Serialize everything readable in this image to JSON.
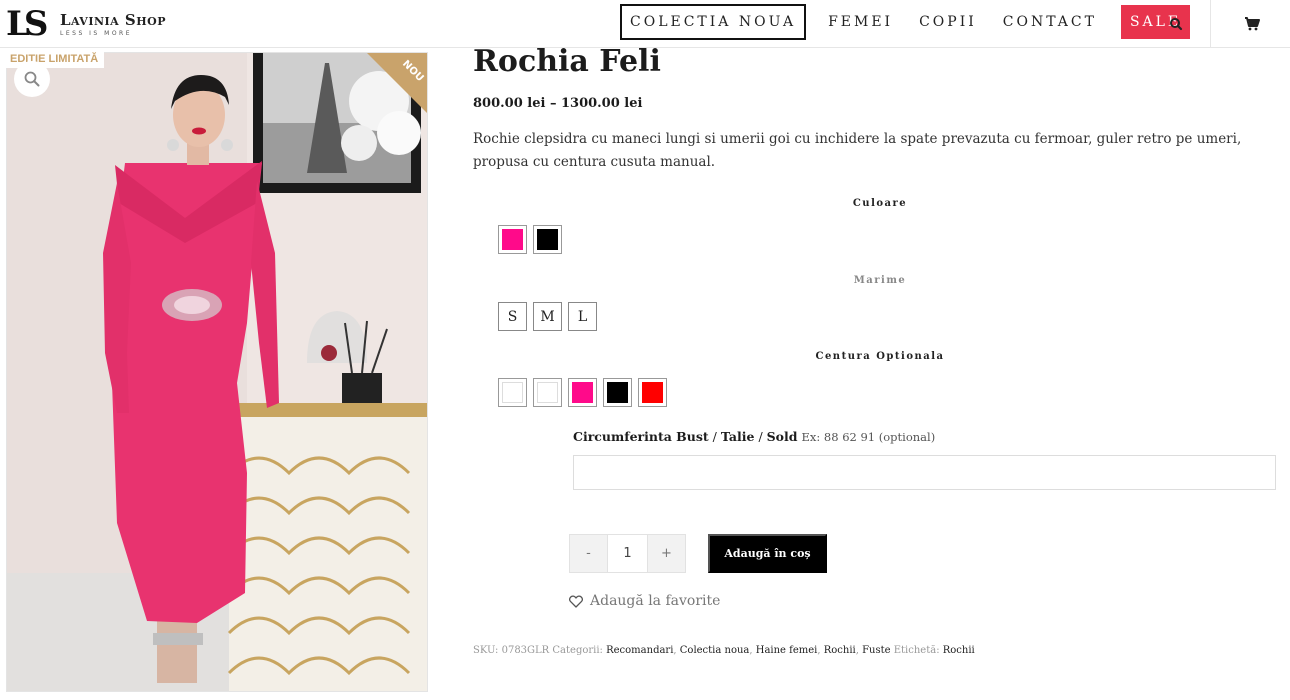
{
  "header": {
    "logo_mark": "LS",
    "logo_name": "Lavinia Shop",
    "logo_tagline": "LESS IS MORE",
    "nav": [
      {
        "label": "COLECTIA NOUA"
      },
      {
        "label": "FEMEI"
      },
      {
        "label": "COPII"
      },
      {
        "label": "CONTACT"
      },
      {
        "label": "SALE"
      }
    ],
    "search_icon": "search-icon",
    "cart_icon": "cart-icon",
    "sale_color": "#e8334d"
  },
  "gallery": {
    "badge_limited": "EDITIE LIMITATĂ",
    "badge_new": "NOU",
    "zoom_icon": "zoom-icon",
    "accent_color": "#c9a36b"
  },
  "product": {
    "title": "Rochia Feli",
    "price": "800.00 lei – 1300.00 lei",
    "description": "Rochie clepsidra cu maneci lungi si umerii goi cu inchidere la spate prevazuta cu fermoar, guler retro pe umeri, propusa cu centura cusuta manual.",
    "color_label": "Culoare",
    "colors": [
      "#ff0a8a",
      "#000000"
    ],
    "size_label": "Marime",
    "sizes": [
      "S",
      "M",
      "L"
    ],
    "belt_label": "Centura Optionala",
    "belt_colors": [
      "#ffffff",
      "#ffffff",
      "#ff0a8a",
      "#000000",
      "#ff0000"
    ],
    "measure_label_1": "Circumferinta Bust",
    "measure_label_2": "Talie",
    "measure_label_3": "Sold",
    "measure_sep": " / ",
    "measure_hint": "Ex: 88 62 91 (optional)",
    "measure_value": "",
    "qty_minus": "-",
    "qty_value": "1",
    "qty_plus": "+",
    "add_to_cart": "Adaugă în coș",
    "favorite": "Adaugă la favorite",
    "favorite_icon": "heart-icon"
  },
  "meta": {
    "sku_label": "SKU:",
    "sku": "0783GLR",
    "categories_label": "Categorii:",
    "categories": [
      "Recomandari",
      "Colectia noua",
      "Haine femei",
      "Rochii",
      "Fuste"
    ],
    "tag_label": "Etichetă:",
    "tag": "Rochii"
  }
}
